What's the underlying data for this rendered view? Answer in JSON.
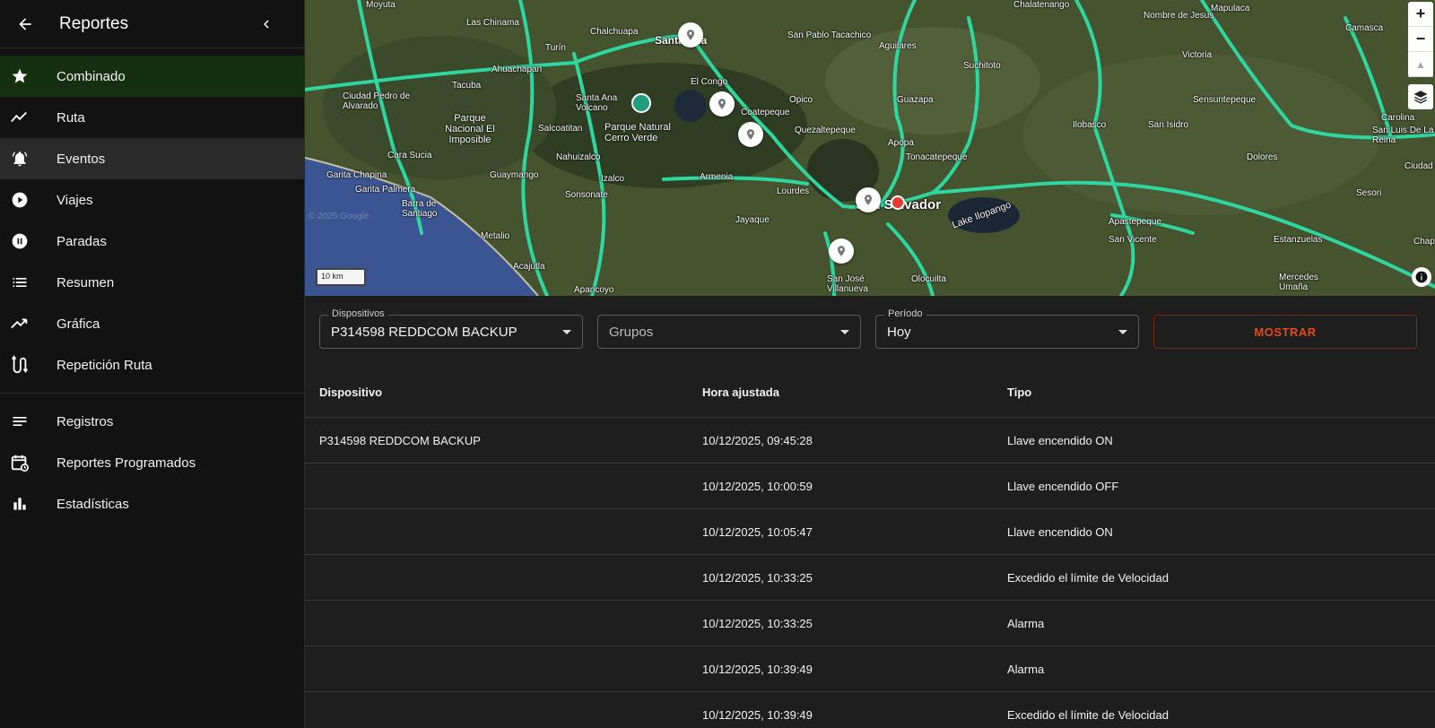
{
  "sidebar": {
    "title": "Reportes",
    "items": [
      {
        "label": "Combinado",
        "icon": "star-icon"
      },
      {
        "label": "Ruta",
        "icon": "route-line-icon"
      },
      {
        "label": "Eventos",
        "icon": "bell-icon"
      },
      {
        "label": "Viajes",
        "icon": "play-circle-icon"
      },
      {
        "label": "Paradas",
        "icon": "pause-circle-icon"
      },
      {
        "label": "Resumen",
        "icon": "list-icon"
      },
      {
        "label": "Gráfica",
        "icon": "trending-up-icon"
      },
      {
        "label": "Repetición Ruta",
        "icon": "route-replay-icon"
      }
    ],
    "items2": [
      {
        "label": "Registros",
        "icon": "notes-icon"
      },
      {
        "label": "Reportes Programados",
        "icon": "calendar-clock-icon"
      },
      {
        "label": "Estadísticas",
        "icon": "bar-chart-icon"
      }
    ]
  },
  "map": {
    "labels": {
      "moyuta": "Moyuta",
      "las_chinama": "Las Chinama",
      "chalchuapa": "Chalchuapa",
      "santa_ana": "Santa Ana",
      "san_pablo_tacachico": "San Pablo Tacachico",
      "aguilares": "Aguilares",
      "chalatenango": "Chalatenango",
      "nombre_de_jesus": "Nombre de Jesus",
      "mapulaca": "Mapulaca",
      "camasca": "Camasca",
      "turin": "Turín",
      "el_congo": "El Congo",
      "suchitoto": "Suchitoto",
      "victoria": "Victoria",
      "ahuachapan": "Ahuachapan",
      "ciudad_pedro": "Ciudad Pedro de Alvarado",
      "tacuba": "Tacuba",
      "santa_ana_volcano": "Santa Ana Volcano",
      "coatepeque": "Coatepeque",
      "opico": "Opico",
      "guazapa": "Guazapa",
      "sensuntepeque": "Sensuntepeque",
      "carolina": "Carolina",
      "parque_el_imposible": "Parque Nacional El Imposible",
      "salcoatitan": "Salcoatitan",
      "parque_cerro_verde": "Parque Natural Cerro Verde",
      "quezaltepeque": "Quezaltepeque",
      "ilobasco": "Ilobasco",
      "san_isidro": "San Isidro",
      "san_luis_reina": "San Luis De La Reina",
      "apopa": "Apopa",
      "garita_chapina": "Garita Chapina",
      "cara_sucia": "Cara Sucia",
      "nahuizalco": "Nahuizalco",
      "tonacatepeque": "Tonacatepeque",
      "dolores": "Dolores",
      "ciudad_b": "Ciudad B",
      "garita_palmera": "Garita Palmera",
      "guaymango": "Guaymango",
      "izalco": "Izalco",
      "armenia": "Armenia",
      "lourdes": "Lourdes",
      "san_salvador": "San Salvador",
      "sesori": "Sesori",
      "barra_de_santiago": "Barra de Santiago",
      "sonsonate": "Sonsonate",
      "jayaque": "Jayaque",
      "lake_ilopango": "Lake Ilopango",
      "apastepeque": "Apastepeque",
      "metalio": "Metalio",
      "san_vicente": "San Vicente",
      "estanzuelas": "Estanzuelas",
      "chape": "Chape",
      "acajutla": "Acajutla",
      "san_jose_villanueva": "San José Villanueva",
      "olocuilta": "Olocuilta",
      "mercedes_umana": "Mercedes Umaña",
      "apancoyo": "Apancoyo"
    },
    "scale": "10 km",
    "watermark": "© 2025 Google",
    "zoom_in": "+",
    "zoom_out": "−"
  },
  "filters": {
    "devices_label": "Dispositivos",
    "devices_value": "P314598 REDDCOM BACKUP",
    "groups_placeholder": "Grupos",
    "period_label": "Período",
    "period_value": "Hoy",
    "show_label": "MOSTRAR"
  },
  "table": {
    "headers": [
      "Dispositivo",
      "Hora ajustada",
      "Tipo"
    ],
    "rows": [
      [
        "P314598 REDDCOM BACKUP",
        "10/12/2025, 09:45:28",
        "Llave encendido ON"
      ],
      [
        "",
        "10/12/2025, 10:00:59",
        "Llave encendido OFF"
      ],
      [
        "",
        "10/12/2025, 10:05:47",
        "Llave encendido ON"
      ],
      [
        "",
        "10/12/2025, 10:33:25",
        "Excedido el límite de Velocidad"
      ],
      [
        "",
        "10/12/2025, 10:33:25",
        "Alarma"
      ],
      [
        "",
        "10/12/2025, 10:39:49",
        "Alarma"
      ],
      [
        "",
        "10/12/2025, 10:39:49",
        "Excedido el límite de Velocidad"
      ]
    ]
  },
  "colors": {
    "active_bg": "#14300f",
    "route": "#2fd6a0",
    "show_button": "#e64a19"
  }
}
